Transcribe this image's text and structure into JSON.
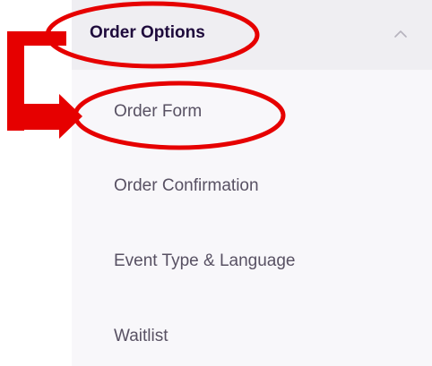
{
  "sidebar": {
    "section_title": "Order Options",
    "section_state_icon": "chevron-up-icon",
    "items": [
      {
        "label": "Order Form"
      },
      {
        "label": "Order Confirmation"
      },
      {
        "label": "Event Type & Language"
      },
      {
        "label": "Waitlist"
      }
    ]
  },
  "colors": {
    "header_background": "#efeef2",
    "panel_background": "#f8f7fa",
    "title_text": "#1e0a3c",
    "item_text": "#585163",
    "annotation_red": "#e60000"
  }
}
